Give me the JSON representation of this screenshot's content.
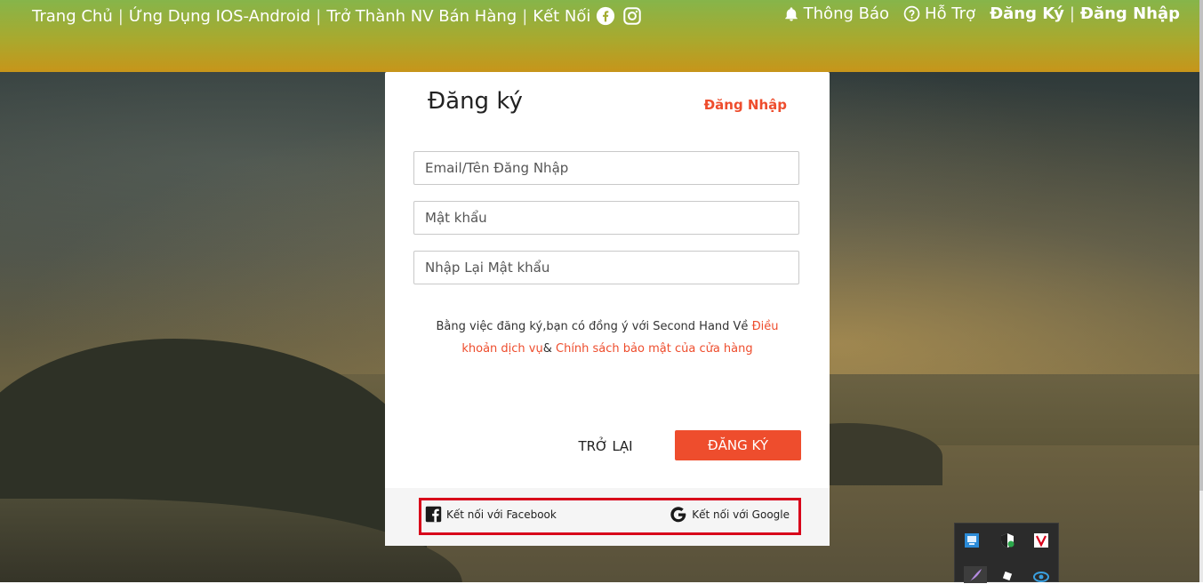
{
  "nav": {
    "home": "Trang Chủ",
    "app": "Ứng Dụng IOS-Android",
    "seller": "Trở Thành NV Bán Hàng",
    "connect": "Kết Nối",
    "notifications": "Thông Báo",
    "help": "Hỗ Trợ",
    "register": "Đăng Ký",
    "login": "Đăng Nhập"
  },
  "form": {
    "title": "Đăng ký",
    "switch_login": "Đăng Nhập",
    "email_placeholder": "Email/Tên Đăng Nhập",
    "password_placeholder": "Mật khẩu",
    "confirm_placeholder": "Nhập Lại Mật khẩu",
    "terms_prefix": "Bằng việc đăng ký,bạn có đồng ý với Second Hand Về ",
    "terms_link": "Điều khoản dịch vụ",
    "terms_and": "& ",
    "privacy_link": "Chính sách bảo mật của cửa hàng",
    "back": "TRỞ LẠI",
    "submit": "ĐĂNG KÝ",
    "facebook": "Kết nối với Facebook",
    "google": "Kết nối với Google"
  },
  "colors": {
    "accent": "#ee4d2d",
    "highlight_border": "#d8001a"
  }
}
